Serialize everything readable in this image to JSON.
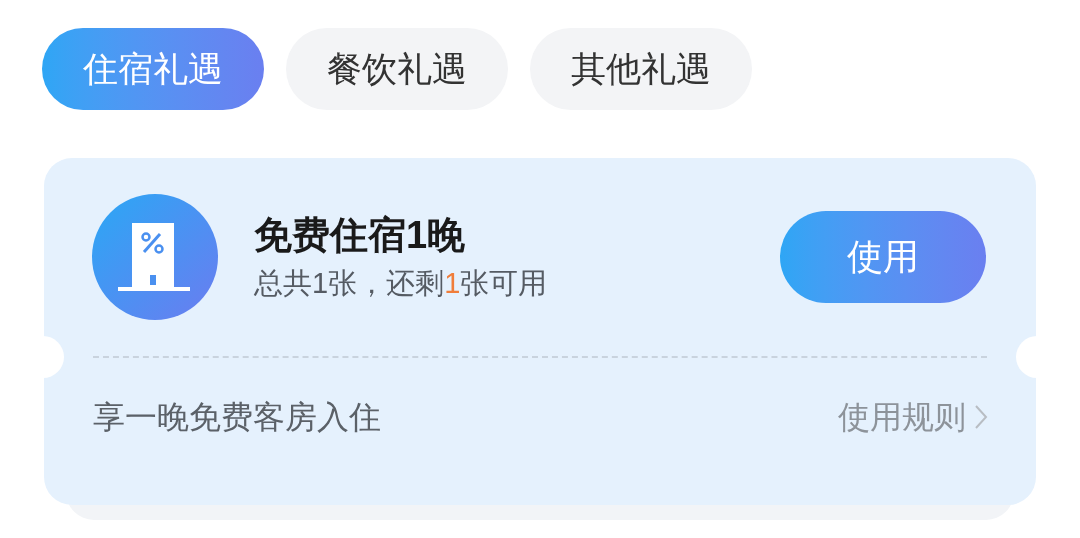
{
  "tabs": [
    {
      "label": "住宿礼遇",
      "selected": true
    },
    {
      "label": "餐饮礼遇",
      "selected": false
    },
    {
      "label": "其他礼遇",
      "selected": false
    }
  ],
  "coupon": {
    "title": "免费住宿1晚",
    "summary": {
      "before": "总共1张，还剩",
      "remaining": "1",
      "after": "张可用"
    },
    "use_button": "使用",
    "description": "享一晚免费客房入住",
    "rules_link": "使用规则"
  }
}
